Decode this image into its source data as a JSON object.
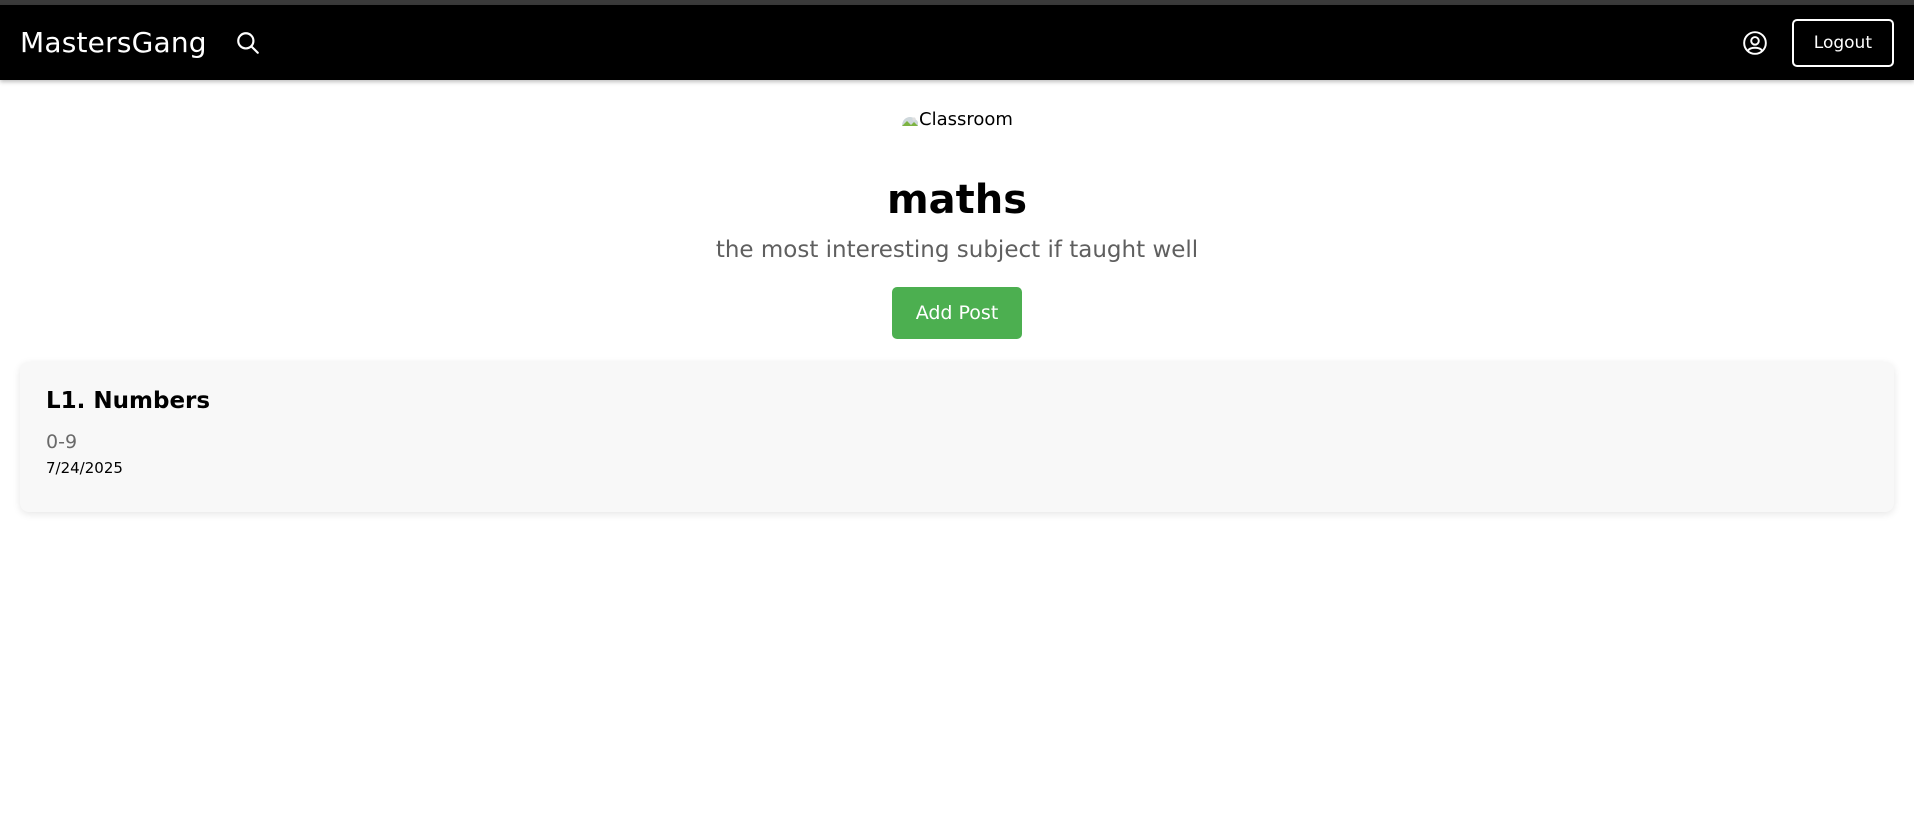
{
  "navbar": {
    "brand": "MastersGang",
    "search_icon": "search-icon",
    "profile_icon": "user-circle-icon",
    "logout_label": "Logout"
  },
  "classroom": {
    "image_alt": "Classroom",
    "title": "maths",
    "description": "the most interesting subject if taught well",
    "add_post_label": "Add Post"
  },
  "posts": [
    {
      "title": "L1. Numbers",
      "description": "0-9",
      "date": "7/24/2025"
    }
  ],
  "colors": {
    "navbar_bg": "#000000",
    "accent_green": "#4caf50",
    "card_bg": "#f8f8f8",
    "subtitle_text": "#5f5f5f"
  }
}
